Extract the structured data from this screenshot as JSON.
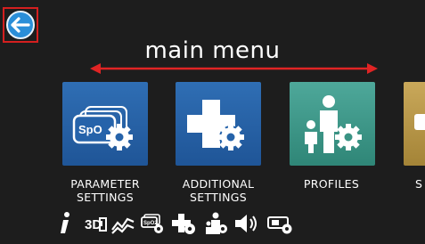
{
  "header": {
    "title": "main menu",
    "back_icon": "back-arrow-icon",
    "accent": "#d41f1f"
  },
  "tiles": [
    {
      "label_line1": "PARAMETER",
      "label_line2": "SETTINGS",
      "icon": "spo2-gear-icon",
      "color": "#2a64ab"
    },
    {
      "label_line1": "ADDITIONAL",
      "label_line2": "SETTINGS",
      "icon": "plus-gear-icon",
      "color": "#2a64ab"
    },
    {
      "label_line1": "PROFILES",
      "label_line2": "",
      "icon": "family-gear-icon",
      "color": "#3e9889"
    },
    {
      "label_line1": "S",
      "label_line2": "",
      "icon": "partial-tile-icon",
      "color": "#b8974a"
    }
  ],
  "bottom_icons": [
    "info-icon",
    "3d-monitor-icon",
    "trend-icon",
    "spo2-settings-icon",
    "plus-settings-icon",
    "profile-settings-icon",
    "volume-icon",
    "device-settings-icon"
  ]
}
